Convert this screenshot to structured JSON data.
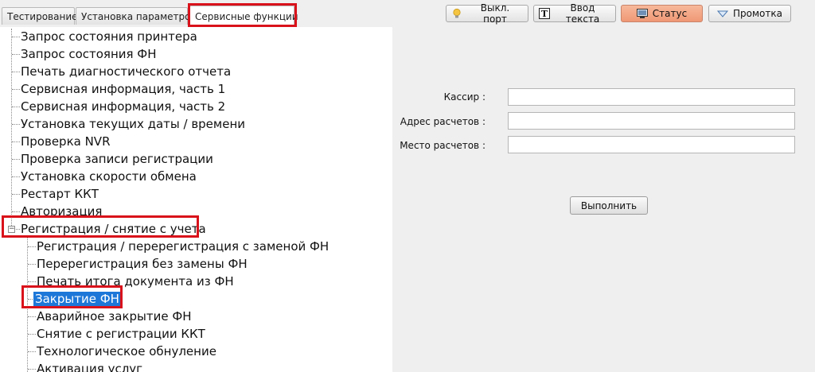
{
  "tabs": [
    {
      "label": "Тестирование"
    },
    {
      "label": "Установка параметров"
    },
    {
      "label": "Сервисные функции"
    }
  ],
  "toolbar": {
    "port_button": "Выкл. порт",
    "text_input_button": "Ввод текста",
    "status_button": "Статус",
    "feed_button": "Промотка"
  },
  "tree": {
    "items": [
      "Запрос состояния принтера",
      "Запрос состояния ФН",
      "Печать диагностического отчета",
      "Сервисная информация, часть 1",
      "Сервисная информация, часть 2",
      "Установка текущих даты / времени",
      "Проверка NVR",
      "Проверка записи регистрации",
      "Установка скорости обмена",
      "Рестарт ККТ",
      "Авторизация",
      "Регистрация / снятие с учета"
    ],
    "children": [
      "Регистрация / перерегистрация с заменой ФН",
      "Перерегистрация без замены ФН",
      "Печать итога документа из ФН",
      "Закрытие ФН",
      "Аварийное закрытие ФН",
      "Снятие с регистрации ККТ",
      "Технологическое обнуление",
      "Активация услуг"
    ],
    "expander_symbol": "−"
  },
  "form": {
    "cashier_label": "Кассир  :",
    "address_label": "Адрес расчетов :",
    "place_label": "Место расчетов  :",
    "cashier_value": "",
    "address_value": "",
    "place_value": "",
    "execute_button": "Выполнить"
  },
  "colors": {
    "highlight_box": "#d9121b",
    "selection": "#1d77d8",
    "status_button": "#ef9875"
  }
}
